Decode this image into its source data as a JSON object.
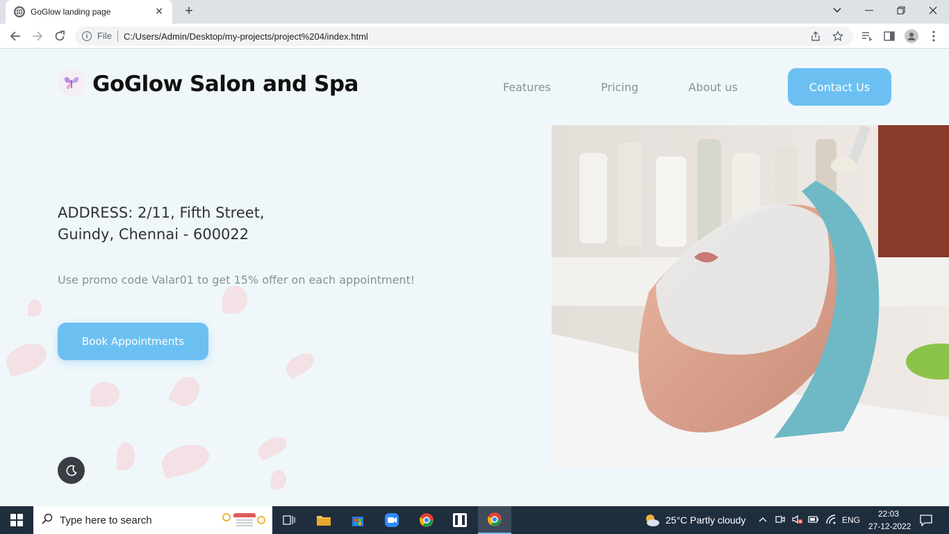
{
  "browser": {
    "tab_title": "GoGlow landing page",
    "new_tab": "+",
    "file_label": "File",
    "url": "C:/Users/Admin/Desktop/my-projects/project%204/index.html"
  },
  "site": {
    "brand": "GoGlow Salon and Spa",
    "nav": [
      "Features",
      "Pricing",
      "About us"
    ],
    "contact_label": "Contact Us",
    "address_line1": "ADDRESS: 2/11, Fifth Street,",
    "address_line2": "Guindy, Chennai - 600022",
    "promo": "Use promo code Valar01 to get 15% offer on each appointment!",
    "book_label": "Book Appointments"
  },
  "taskbar": {
    "search_placeholder": "Type here to search",
    "weather": "25°C  Partly cloudy",
    "lang": "ENG",
    "time": "22:03",
    "date": "27-12-2022"
  },
  "colors": {
    "accent": "#6cc0f1",
    "page_bg": "#eff7fa",
    "taskbar_bg": "#1f2e3d"
  },
  "icons": [
    "globe-icon",
    "close-icon",
    "back-icon",
    "forward-icon",
    "reload-icon",
    "info-icon",
    "share-icon",
    "star-icon",
    "reading-list-icon",
    "side-panel-icon",
    "profile-icon",
    "menu-icon",
    "moon-icon",
    "butterfly-logo-icon",
    "windows-start-icon",
    "search-icon",
    "task-view-icon",
    "file-explorer-icon",
    "store-icon",
    "zoom-icon",
    "chrome-icon",
    "weather-icon",
    "wifi-icon",
    "volume-muted-icon",
    "notification-icon"
  ]
}
